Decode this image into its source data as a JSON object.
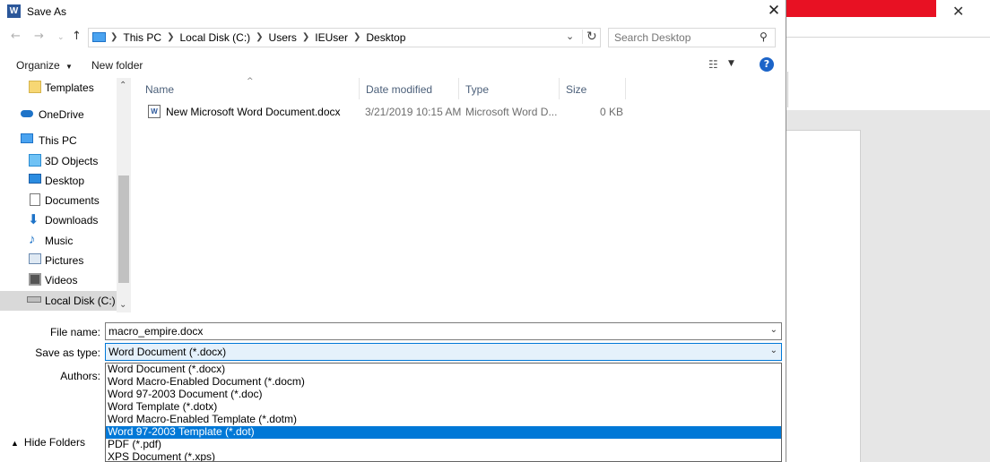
{
  "dialog": {
    "title": "Save As",
    "app_icon_letter": "W"
  },
  "address": {
    "crumbs": [
      "This PC",
      "Local Disk (C:)",
      "Users",
      "IEUser",
      "Desktop"
    ],
    "search_placeholder": "Search Desktop"
  },
  "toolbar": {
    "organize_label": "Organize",
    "new_folder_label": "New folder"
  },
  "nav": {
    "items": [
      {
        "label": "Templates",
        "icon": "folder-icon"
      },
      {
        "label": "OneDrive",
        "icon": "onedrive-icon"
      },
      {
        "label": "This PC",
        "icon": "this-pc-icon"
      },
      {
        "label": "3D Objects",
        "icon": "3d-objects-icon"
      },
      {
        "label": "Desktop",
        "icon": "desktop-icon"
      },
      {
        "label": "Documents",
        "icon": "documents-icon"
      },
      {
        "label": "Downloads",
        "icon": "downloads-icon"
      },
      {
        "label": "Music",
        "icon": "music-icon"
      },
      {
        "label": "Pictures",
        "icon": "pictures-icon"
      },
      {
        "label": "Videos",
        "icon": "videos-icon"
      },
      {
        "label": "Local Disk (C:)",
        "icon": "drive-icon"
      }
    ],
    "selected_index": 10
  },
  "files": {
    "columns": [
      "Name",
      "Date modified",
      "Type",
      "Size"
    ],
    "rows": [
      {
        "name": "New Microsoft Word Document.docx",
        "date": "3/21/2019 10:15 AM",
        "type": "Microsoft Word D...",
        "size": "0 KB"
      }
    ]
  },
  "form": {
    "file_name_label": "File name:",
    "file_name_value": "macro_empire.docx",
    "save_type_label": "Save as type:",
    "save_type_value": "Word Document (*.docx)",
    "authors_label": "Authors:",
    "type_options": [
      "Word Document (*.docx)",
      "Word Macro-Enabled Document (*.docm)",
      "Word 97-2003 Document (*.doc)",
      "Word Template (*.dotx)",
      "Word Macro-Enabled Template (*.dotm)",
      "Word 97-2003 Template (*.dot)",
      "PDF (*.pdf)",
      "XPS Document (*.xps)"
    ],
    "highlighted_option_index": 5,
    "hide_folders_label": "Hide Folders"
  },
  "colors": {
    "accent": "#0078d7",
    "word_blue": "#2b579a",
    "background_red": "#e81123"
  }
}
